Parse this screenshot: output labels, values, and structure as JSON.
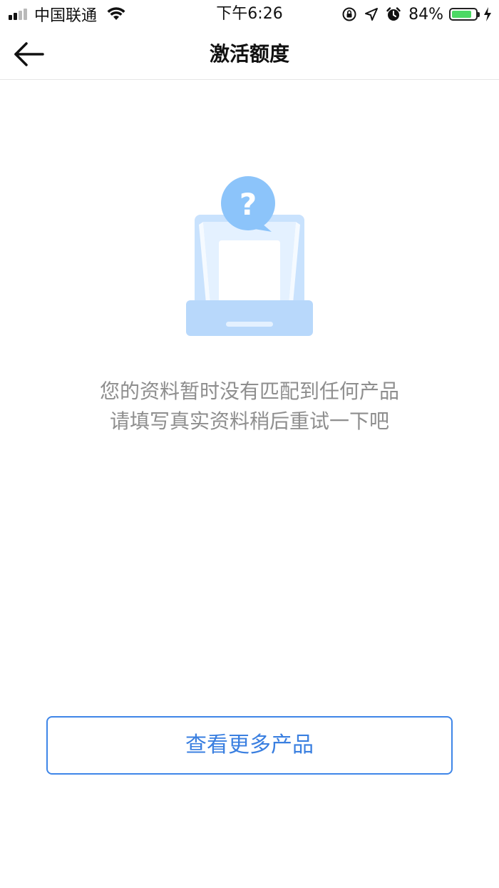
{
  "status_bar": {
    "carrier": "中国联通",
    "time": "下午6:26",
    "battery_text": "84%",
    "battery_level": 0.84,
    "battery_color": "#4cd964"
  },
  "nav": {
    "title": "激活额度",
    "back_icon": "arrow-left-icon"
  },
  "illustration": {
    "icon": "empty-inbox-question-icon",
    "badge_symbol": "?"
  },
  "message": {
    "line1": "您的资料暂时没有匹配到任何产品",
    "line2": "请填写真实资料稍后重试一下吧"
  },
  "actions": {
    "more_products_label": "查看更多产品",
    "accent_color": "#3f86e8"
  }
}
